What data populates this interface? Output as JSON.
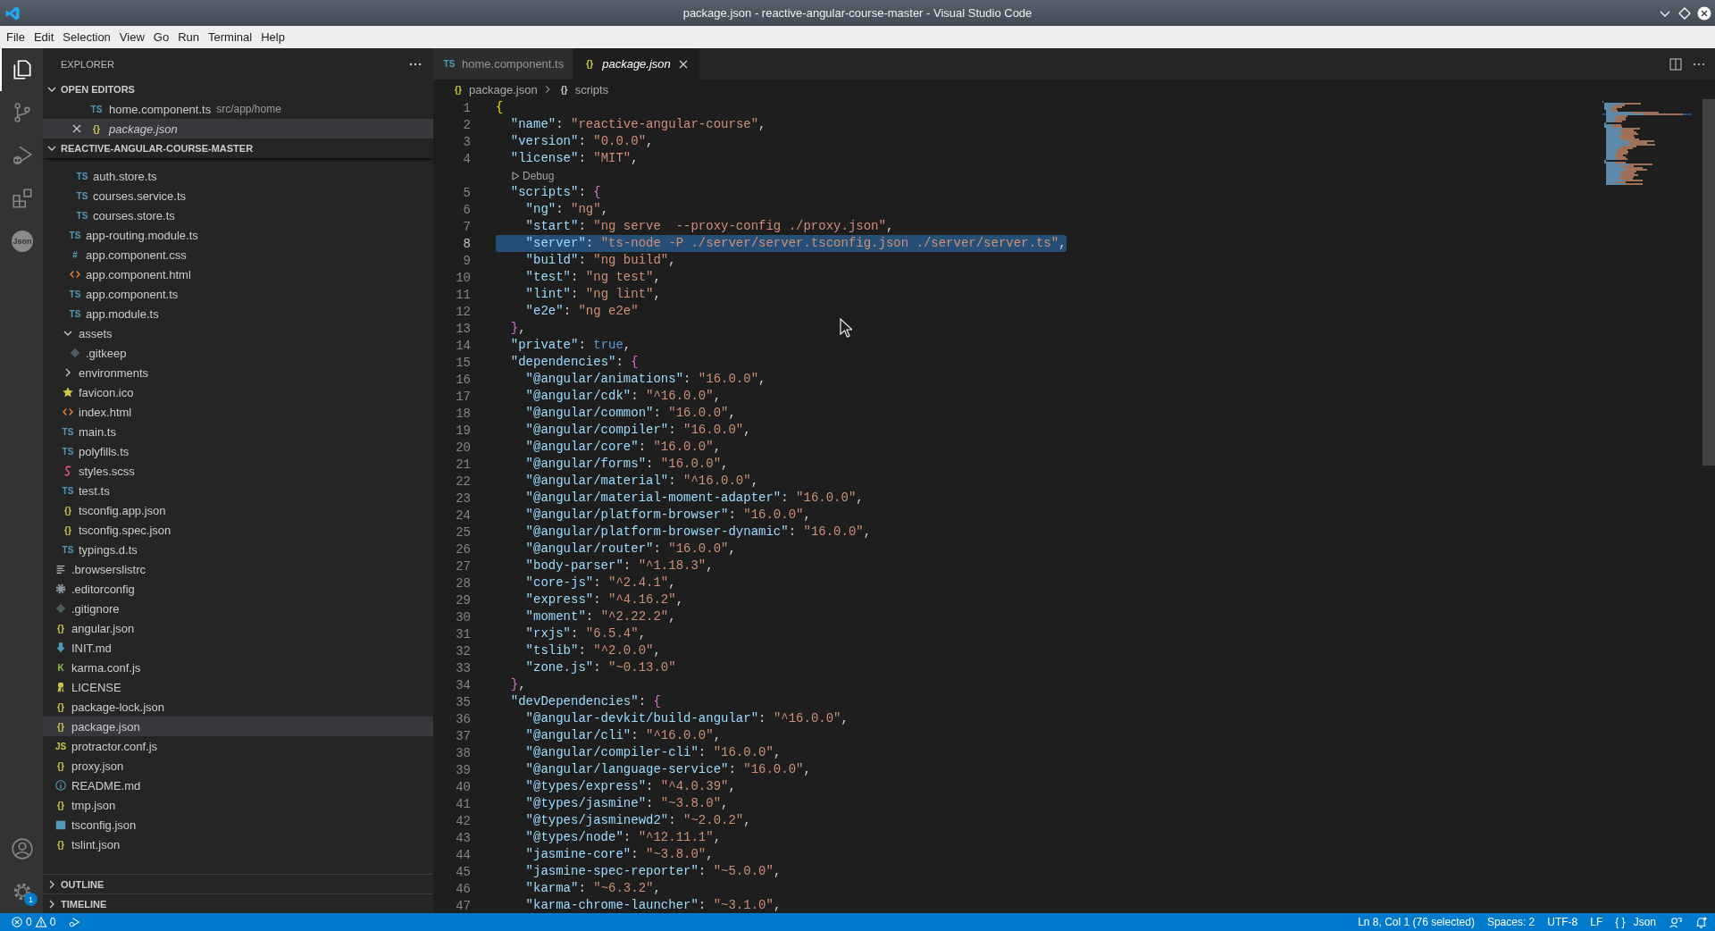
{
  "window": {
    "title": "package.json - reactive-angular-course-master - Visual Studio Code"
  },
  "menu": [
    "File",
    "Edit",
    "Selection",
    "View",
    "Go",
    "Run",
    "Terminal",
    "Help"
  ],
  "activity_bar": {
    "top": [
      {
        "kind": "files",
        "selected": true
      },
      {
        "kind": "source-control",
        "selected": false
      },
      {
        "kind": "run-debug",
        "selected": false
      },
      {
        "kind": "extensions",
        "selected": false
      },
      {
        "kind": "json",
        "label": "Json",
        "selected": false
      }
    ],
    "bottom": [
      {
        "kind": "account"
      },
      {
        "kind": "settings",
        "badge": "1"
      }
    ]
  },
  "explorer": {
    "title": "EXPLORER",
    "open_editors": {
      "title": "OPEN EDITORS",
      "expanded": true,
      "items": [
        {
          "label": "home.component.ts",
          "description": "src/app/home",
          "kind": "ts",
          "icon_text": "TS",
          "preview": false,
          "selected": false,
          "show_close": false
        },
        {
          "label": "package.json",
          "kind": "json",
          "icon_text": "{}",
          "preview": true,
          "selected": true,
          "show_close": true
        }
      ]
    },
    "folder": {
      "title": "REACTIVE-ANGULAR-COURSE-MASTER",
      "expanded": true,
      "tree": [
        {
          "children": [
            {
              "children": [
                {
                  "children": [
                    {
                      "label": "auth.store.ts",
                      "kind": "ts",
                      "icon_text": "TS",
                      "selected": false
                    },
                    {
                      "label": "courses.service.ts",
                      "kind": "ts",
                      "icon_text": "TS",
                      "selected": false
                    },
                    {
                      "label": "courses.store.ts",
                      "kind": "ts",
                      "icon_text": "TS",
                      "selected": false
                    }
                  ]
                },
                {
                  "label": "app-routing.module.ts",
                  "kind": "ts",
                  "icon_text": "TS",
                  "selected": false
                },
                {
                  "label": "app.component.css",
                  "kind": "css",
                  "icon_text": "#",
                  "selected": false
                },
                {
                  "label": "app.component.html",
                  "kind": "html",
                  "selected": false
                },
                {
                  "label": "app.component.ts",
                  "kind": "ts",
                  "icon_text": "TS",
                  "selected": false
                },
                {
                  "label": "app.module.ts",
                  "kind": "ts",
                  "icon_text": "TS",
                  "selected": false
                }
              ]
            },
            {
              "label": "assets",
              "kind": "folder",
              "expanded": true,
              "selected": false,
              "children": [
                {
                  "label": ".gitkeep",
                  "kind": "git",
                  "selected": false
                }
              ]
            },
            {
              "label": "environments",
              "kind": "folder",
              "expanded": false,
              "selected": false
            },
            {
              "label": "favicon.ico",
              "kind": "star",
              "selected": false
            },
            {
              "label": "index.html",
              "kind": "html",
              "selected": false
            },
            {
              "label": "main.ts",
              "kind": "ts",
              "icon_text": "TS",
              "selected": false
            },
            {
              "label": "polyfills.ts",
              "kind": "ts",
              "icon_text": "TS",
              "selected": false
            },
            {
              "label": "styles.scss",
              "kind": "scss",
              "selected": false
            },
            {
              "label": "test.ts",
              "kind": "ts",
              "icon_text": "TS",
              "selected": false
            },
            {
              "label": "tsconfig.app.json",
              "kind": "json",
              "icon_text": "{}",
              "selected": false
            },
            {
              "label": "tsconfig.spec.json",
              "kind": "json",
              "icon_text": "{}",
              "selected": false
            },
            {
              "label": "typings.d.ts",
              "kind": "ts",
              "icon_text": "TS",
              "selected": false
            }
          ]
        },
        {
          "label": ".browserslistrc",
          "kind": "lines",
          "selected": false
        },
        {
          "label": ".editorconfig",
          "kind": "gear",
          "selected": false
        },
        {
          "label": ".gitignore",
          "kind": "git",
          "selected": false
        },
        {
          "label": "angular.json",
          "kind": "json",
          "icon_text": "{}",
          "selected": false
        },
        {
          "label": "INIT.md",
          "kind": "download",
          "selected": false
        },
        {
          "label": "karma.conf.js",
          "kind": "karma",
          "icon_text": "K",
          "selected": false
        },
        {
          "label": "LICENSE",
          "kind": "license",
          "selected": false
        },
        {
          "label": "package-lock.json",
          "kind": "json",
          "icon_text": "{}",
          "selected": false
        },
        {
          "label": "package.json",
          "kind": "json",
          "icon_text": "{}",
          "selected": true
        },
        {
          "label": "protractor.conf.js",
          "kind": "js",
          "icon_text": "JS",
          "selected": false
        },
        {
          "label": "proxy.json",
          "kind": "json",
          "icon_text": "{}",
          "selected": false
        },
        {
          "label": "README.md",
          "kind": "info",
          "selected": false
        },
        {
          "label": "tmp.json",
          "kind": "json",
          "icon_text": "{}",
          "selected": false
        },
        {
          "label": "tsconfig.json",
          "kind": "tsconfig",
          "selected": false
        },
        {
          "label": "tslint.json",
          "kind": "json",
          "icon_text": "{}",
          "selected": false
        }
      ]
    },
    "panels": [
      {
        "title": "OUTLINE",
        "expanded": false
      },
      {
        "title": "TIMELINE",
        "expanded": false
      }
    ]
  },
  "editor": {
    "tabs": [
      {
        "label": "home.component.ts",
        "kind": "ts",
        "icon_text": "TS",
        "selected": false,
        "preview": false,
        "show_close": false
      },
      {
        "label": "package.json",
        "kind": "json",
        "icon_text": "{}",
        "selected": true,
        "preview": true,
        "show_close": true
      }
    ],
    "breadcrumb": [
      {
        "kind": "json",
        "icon_text": "{}",
        "label": "package.json"
      },
      {
        "kind": "object",
        "icon_text": "{}",
        "label": "scripts"
      }
    ],
    "lines": [
      {
        "kind": "code",
        "number": "1",
        "text": "{",
        "selected": false
      },
      {
        "kind": "code",
        "number": "2",
        "text": "  \"name\": \"reactive-angular-course\",",
        "selected": false
      },
      {
        "kind": "code",
        "number": "3",
        "text": "  \"version\": \"0.0.0\",",
        "selected": false
      },
      {
        "kind": "code",
        "number": "4",
        "text": "  \"license\": \"MIT\",",
        "selected": false
      },
      {
        "kind": "codelens",
        "text": "Debug"
      },
      {
        "kind": "code",
        "number": "5",
        "text": "  \"scripts\": {",
        "selected": false
      },
      {
        "kind": "code",
        "number": "6",
        "text": "    \"ng\": \"ng\",",
        "selected": false
      },
      {
        "kind": "code",
        "number": "7",
        "text": "    \"start\": \"ng serve  --proxy-config ./proxy.json\",",
        "selected": false
      },
      {
        "kind": "code",
        "number": "8",
        "text": "    \"server\": \"ts-node -P ./server/server.tsconfig.json ./server/server.ts\",",
        "selected": true
      },
      {
        "kind": "code",
        "number": "9",
        "text": "    \"build\": \"ng build\",",
        "selected": false
      },
      {
        "kind": "code",
        "number": "10",
        "text": "    \"test\": \"ng test\",",
        "selected": false
      },
      {
        "kind": "code",
        "number": "11",
        "text": "    \"lint\": \"ng lint\",",
        "selected": false
      },
      {
        "kind": "code",
        "number": "12",
        "text": "    \"e2e\": \"ng e2e\"",
        "selected": false
      },
      {
        "kind": "code",
        "number": "13",
        "text": "  },",
        "selected": false
      },
      {
        "kind": "code",
        "number": "14",
        "text": "  \"private\": true,",
        "selected": false
      },
      {
        "kind": "code",
        "number": "15",
        "text": "  \"dependencies\": {",
        "selected": false
      },
      {
        "kind": "code",
        "number": "16",
        "text": "    \"@angular/animations\": \"16.0.0\",",
        "selected": false
      },
      {
        "kind": "code",
        "number": "17",
        "text": "    \"@angular/cdk\": \"^16.0.0\",",
        "selected": false
      },
      {
        "kind": "code",
        "number": "18",
        "text": "    \"@angular/common\": \"16.0.0\",",
        "selected": false
      },
      {
        "kind": "code",
        "number": "19",
        "text": "    \"@angular/compiler\": \"16.0.0\",",
        "selected": false
      },
      {
        "kind": "code",
        "number": "20",
        "text": "    \"@angular/core\": \"16.0.0\",",
        "selected": false
      },
      {
        "kind": "code",
        "number": "21",
        "text": "    \"@angular/forms\": \"16.0.0\",",
        "selected": false
      },
      {
        "kind": "code",
        "number": "22",
        "text": "    \"@angular/material\": \"^16.0.0\",",
        "selected": false
      },
      {
        "kind": "code",
        "number": "23",
        "text": "    \"@angular/material-moment-adapter\": \"16.0.0\",",
        "selected": false
      },
      {
        "kind": "code",
        "number": "24",
        "text": "    \"@angular/platform-browser\": \"16.0.0\",",
        "selected": false
      },
      {
        "kind": "code",
        "number": "25",
        "text": "    \"@angular/platform-browser-dynamic\": \"16.0.0\",",
        "selected": false
      },
      {
        "kind": "code",
        "number": "26",
        "text": "    \"@angular/router\": \"16.0.0\",",
        "selected": false
      },
      {
        "kind": "code",
        "number": "27",
        "text": "    \"body-parser\": \"^1.18.3\",",
        "selected": false
      },
      {
        "kind": "code",
        "number": "28",
        "text": "    \"core-js\": \"^2.4.1\",",
        "selected": false
      },
      {
        "kind": "code",
        "number": "29",
        "text": "    \"express\": \"^4.16.2\",",
        "selected": false
      },
      {
        "kind": "code",
        "number": "30",
        "text": "    \"moment\": \"^2.22.2\",",
        "selected": false
      },
      {
        "kind": "code",
        "number": "31",
        "text": "    \"rxjs\": \"6.5.4\",",
        "selected": false
      },
      {
        "kind": "code",
        "number": "32",
        "text": "    \"tslib\": \"^2.0.0\",",
        "selected": false
      },
      {
        "kind": "code",
        "number": "33",
        "text": "    \"zone.js\": \"~0.13.0\"",
        "selected": false
      },
      {
        "kind": "code",
        "number": "34",
        "text": "  },",
        "selected": false
      },
      {
        "kind": "code",
        "number": "35",
        "text": "  \"devDependencies\": {",
        "selected": false
      },
      {
        "kind": "code",
        "number": "36",
        "text": "    \"@angular-devkit/build-angular\": \"^16.0.0\",",
        "selected": false
      },
      {
        "kind": "code",
        "number": "37",
        "text": "    \"@angular/cli\": \"^16.0.0\",",
        "selected": false
      },
      {
        "kind": "code",
        "number": "38",
        "text": "    \"@angular/compiler-cli\": \"16.0.0\",",
        "selected": false
      },
      {
        "kind": "code",
        "number": "39",
        "text": "    \"@angular/language-service\": \"16.0.0\",",
        "selected": false
      },
      {
        "kind": "code",
        "number": "40",
        "text": "    \"@types/express\": \"^4.0.39\",",
        "selected": false
      },
      {
        "kind": "code",
        "number": "41",
        "text": "    \"@types/jasmine\": \"~3.8.0\",",
        "selected": false
      },
      {
        "kind": "code",
        "number": "42",
        "text": "    \"@types/jasminewd2\": \"~2.0.2\",",
        "selected": false
      },
      {
        "kind": "code",
        "number": "43",
        "text": "    \"@types/node\": \"^12.11.1\",",
        "selected": false
      },
      {
        "kind": "code",
        "number": "44",
        "text": "    \"jasmine-core\": \"~3.8.0\",",
        "selected": false
      },
      {
        "kind": "code",
        "number": "45",
        "text": "    \"jasmine-spec-reporter\": \"~5.0.0\",",
        "selected": false
      },
      {
        "kind": "code",
        "number": "46",
        "text": "    \"karma\": \"~6.3.2\",",
        "selected": false
      },
      {
        "kind": "code",
        "number": "47",
        "text": "    \"karma-chrome-launcher\": \"~3.1.0\",",
        "selected": false
      }
    ]
  },
  "status_bar": {
    "errors": "0",
    "warnings": "0",
    "items": [
      {
        "kind": "text",
        "label": "Ln 8, Col 1 (76 selected)"
      },
      {
        "kind": "text",
        "label": "Spaces: 2"
      },
      {
        "kind": "text",
        "label": "UTF-8"
      },
      {
        "kind": "text",
        "label": "LF"
      },
      {
        "kind": "language",
        "icon_text": "{ }",
        "label": "Json"
      },
      {
        "kind": "feedback"
      },
      {
        "kind": "notifications"
      }
    ]
  }
}
